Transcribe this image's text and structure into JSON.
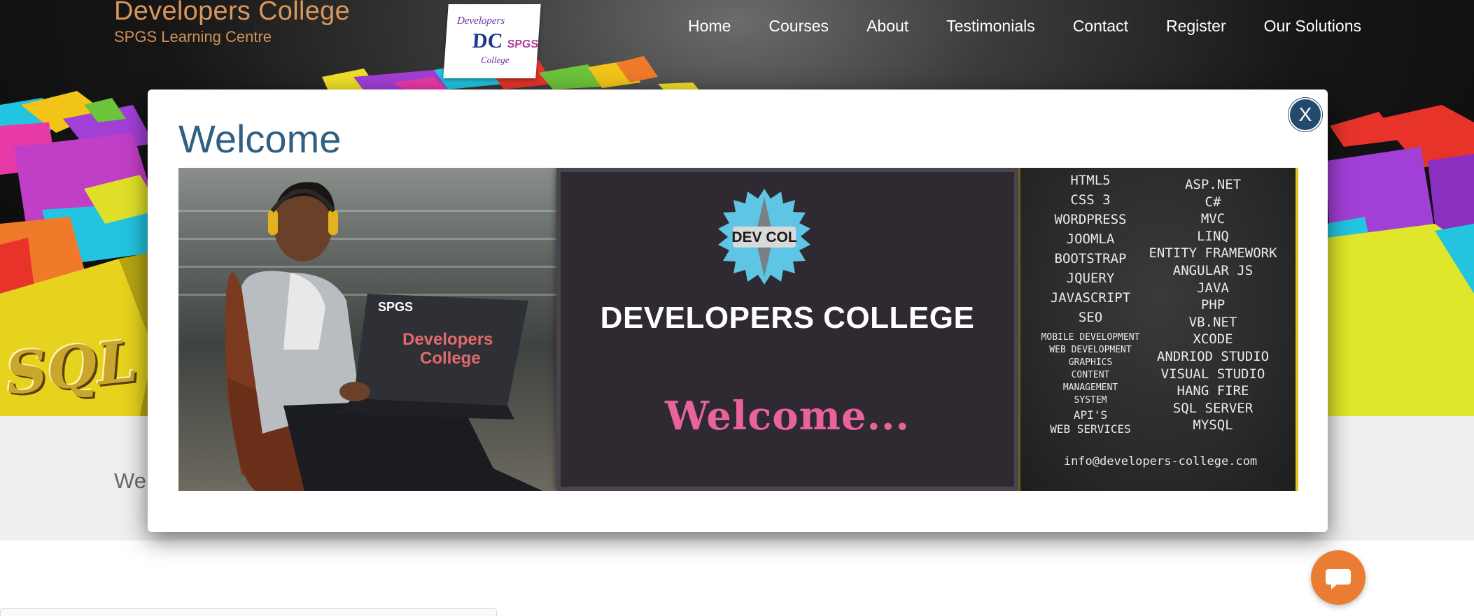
{
  "brand": {
    "title": "Developers College",
    "subtitle": "SPGS Learning Centre",
    "logo_text_top": "Developers",
    "logo_text_bottom": "College",
    "logo_badge": "SPGS"
  },
  "nav": {
    "items": [
      "Home",
      "Courses",
      "About",
      "Testimonials",
      "Contact",
      "Register",
      "Our Solutions"
    ]
  },
  "hero": {
    "decor_text": "SQL"
  },
  "page": {
    "intro_text": "We"
  },
  "modal": {
    "title": "Welcome",
    "close_label": "X",
    "banner": {
      "laptop_text_1": "Developers",
      "laptop_text_2": "College",
      "laptop_logo": "SPGS",
      "badge_text": "DEV COL",
      "center_title": "DEVELOPERS COLLEGE",
      "center_welcome": "Welcome...",
      "chalk_left": [
        "HTML5",
        "CSS 3",
        "WORDPRESS",
        "JOOMLA",
        "BOOTSTRAP",
        "JQUERY",
        "JAVASCRIPT",
        "SEO"
      ],
      "chalk_left_small": [
        "MOBILE DEVELOPMENT",
        "WEB DEVELOPMENT",
        "GRAPHICS",
        "CONTENT",
        "MANAGEMENT",
        "SYSTEM"
      ],
      "chalk_left_bottom": [
        "API'S",
        "WEB SERVICES"
      ],
      "chalk_right": [
        "ASP.NET",
        "C#",
        "MVC",
        "LINQ",
        "ENTITY FRAMEWORK",
        "ANGULAR JS",
        "JAVA",
        "PHP",
        "VB.NET",
        "XCODE",
        "ANDRIOD STUDIO",
        "VISUAL STUDIO",
        "HANG FIRE",
        "SQL SERVER",
        "MYSQL"
      ],
      "chalk_email": "info@developers-college.com"
    }
  },
  "chat": {
    "icon": "chat-bubble-icon"
  },
  "colors": {
    "brand_orange": "#d9965a",
    "modal_title": "#2f5f82",
    "close_button": "#234a6c",
    "chat_button": "#ea7d33",
    "welcome_pink": "#e8639a"
  }
}
